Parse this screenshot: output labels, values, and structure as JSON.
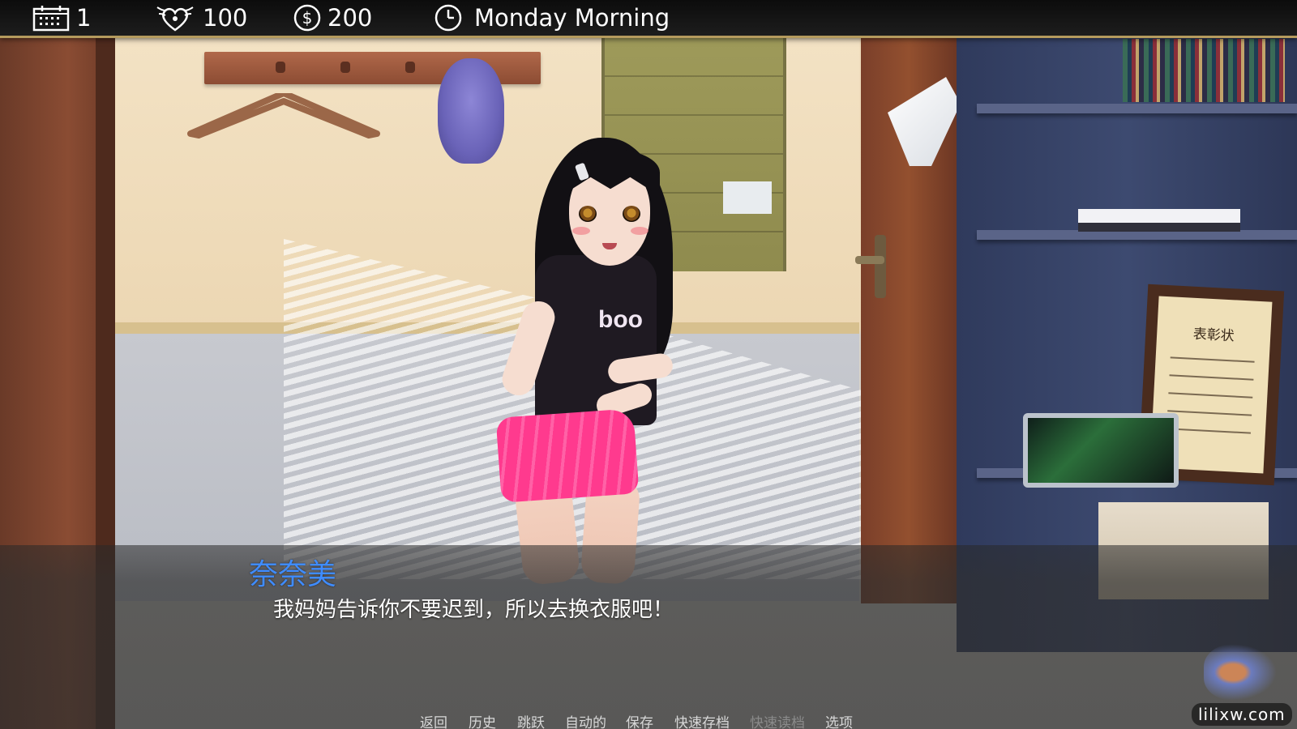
{
  "hud": {
    "day_icon": "calendar-icon",
    "day_value": "1",
    "affection_icon": "heart-emblem-icon",
    "affection_value": "100",
    "money_icon": "dollar-coin-icon",
    "money_value": "200",
    "time_icon": "clock-icon",
    "time_value": "Monday Morning",
    "accent_color": "#b59b5d"
  },
  "scene": {
    "certificate_title": "表彰状",
    "shirt_logo": "boo"
  },
  "dialogue": {
    "speaker": "奈奈美",
    "speaker_color": "#3f8cff",
    "text": "我妈妈告诉你不要迟到，所以去换衣服吧！"
  },
  "quick_menu": {
    "items": [
      {
        "label": "返回",
        "enabled": true
      },
      {
        "label": "历史",
        "enabled": true
      },
      {
        "label": "跳跃",
        "enabled": true
      },
      {
        "label": "自动的",
        "enabled": true
      },
      {
        "label": "保存",
        "enabled": true
      },
      {
        "label": "快速存档",
        "enabled": true
      },
      {
        "label": "快速读档",
        "enabled": false
      },
      {
        "label": "选项",
        "enabled": true
      }
    ]
  },
  "watermark": {
    "text": "lilixw.com"
  }
}
